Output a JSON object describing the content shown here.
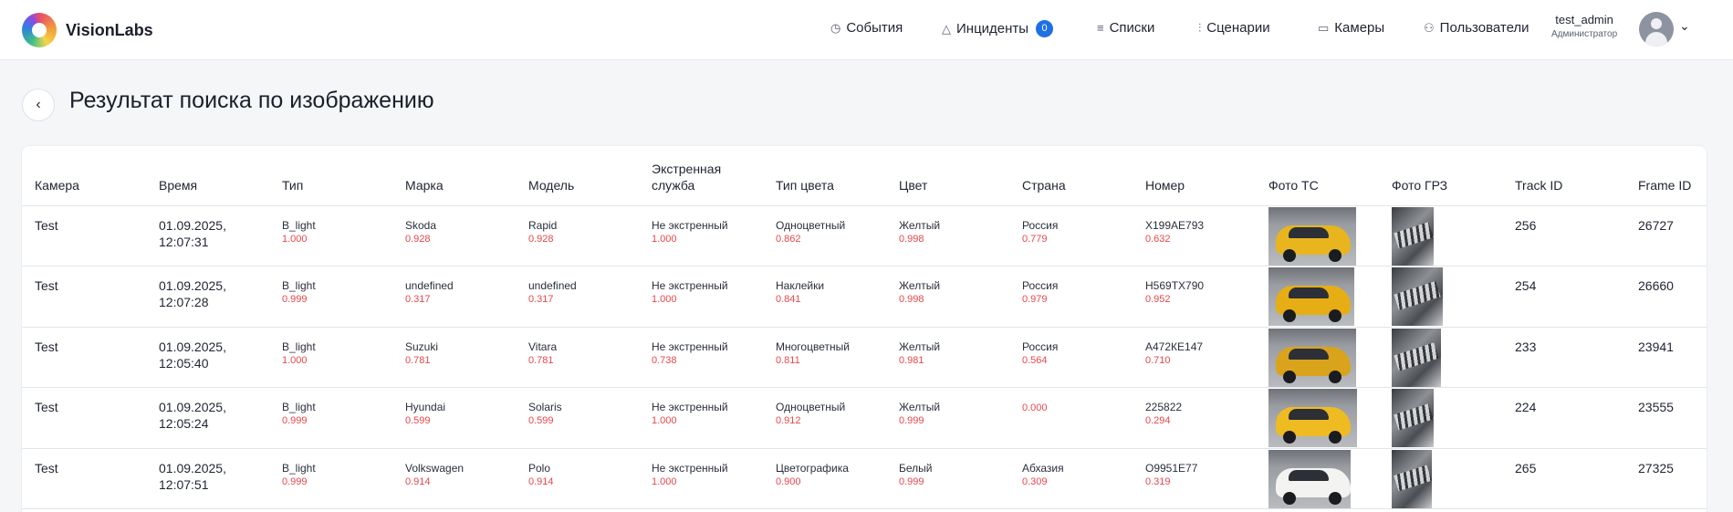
{
  "app": {
    "name": "VisionLabs"
  },
  "nav": [
    {
      "label": "События",
      "icon": "clock-icon",
      "glyph": "◷"
    },
    {
      "label": "Инциденты",
      "icon": "warning-icon",
      "glyph": "△",
      "badge": "0"
    },
    {
      "label": "Списки",
      "icon": "list-icon",
      "glyph": "≡"
    },
    {
      "label": "Сценарии",
      "icon": "sliders-icon",
      "glyph": "⫶"
    },
    {
      "label": "Камеры",
      "icon": "camera-icon",
      "glyph": "▭"
    },
    {
      "label": "Пользователи",
      "icon": "users-icon",
      "glyph": "⚇"
    }
  ],
  "user": {
    "name": "test_admin",
    "role": "Администратор"
  },
  "page": {
    "title": "Результат поиска по изображению",
    "back_glyph": "‹"
  },
  "table": {
    "columns": [
      "Камера",
      "Время",
      "Тип",
      "Марка",
      "Модель",
      "Экстренная служба",
      "Тип цвета",
      "Цвет",
      "Страна",
      "Номер",
      "Фото ТС",
      "Фото ГРЗ",
      "Track ID",
      "Frame ID"
    ],
    "rows": [
      {
        "camera": "Test",
        "time": "01.09.2025, 12:07:31",
        "type": "B_light",
        "type_score": "1.000",
        "make": "Skoda",
        "make_score": "0.928",
        "model": "Rapid",
        "model_score": "0.928",
        "emergency": "Не экстренный",
        "emergency_score": "1.000",
        "color_type": "Одноцветный",
        "color_type_score": "0.862",
        "color": "Желтый",
        "color_score": "0.998",
        "country": "Россия",
        "country_score": "0.779",
        "plate": "Х199АЕ793",
        "plate_score": "0.632",
        "track_id": "256",
        "frame_id": "26727",
        "car_color": "#e8b51f"
      },
      {
        "camera": "Test",
        "time": "01.09.2025, 12:07:28",
        "type": "B_light",
        "type_score": "0.999",
        "make": "undefined",
        "make_score": "0.317",
        "model": "undefined",
        "model_score": "0.317",
        "emergency": "Не экстренный",
        "emergency_score": "1.000",
        "color_type": "Наклейки",
        "color_type_score": "0.841",
        "color": "Желтый",
        "color_score": "0.998",
        "country": "Россия",
        "country_score": "0.979",
        "plate": "Н569ТХ790",
        "plate_score": "0.952",
        "track_id": "254",
        "frame_id": "26660",
        "car_color": "#e6ae14"
      },
      {
        "camera": "Test",
        "time": "01.09.2025, 12:05:40",
        "type": "B_light",
        "type_score": "1.000",
        "make": "Suzuki",
        "make_score": "0.781",
        "model": "Vitara",
        "model_score": "0.781",
        "emergency": "Не экстренный",
        "emergency_score": "0.738",
        "color_type": "Многоцветный",
        "color_type_score": "0.811",
        "color": "Желтый",
        "color_score": "0.981",
        "country": "Россия",
        "country_score": "0.564",
        "plate": "А472КЕ147",
        "plate_score": "0.710",
        "track_id": "233",
        "frame_id": "23941",
        "car_color": "#d9a41c"
      },
      {
        "camera": "Test",
        "time": "01.09.2025, 12:05:24",
        "type": "B_light",
        "type_score": "0.999",
        "make": "Hyundai",
        "make_score": "0.599",
        "model": "Solaris",
        "model_score": "0.599",
        "emergency": "Не экстренный",
        "emergency_score": "1.000",
        "color_type": "Одноцветный",
        "color_type_score": "0.912",
        "color": "Желтый",
        "color_score": "0.999",
        "country": "",
        "country_score": "0.000",
        "plate": "225822",
        "plate_score": "0.294",
        "track_id": "224",
        "frame_id": "23555",
        "car_color": "#efbb22"
      },
      {
        "camera": "Test",
        "time": "01.09.2025, 12:07:51",
        "type": "B_light",
        "type_score": "0.999",
        "make": "Volkswagen",
        "make_score": "0.914",
        "model": "Polo",
        "model_score": "0.914",
        "emergency": "Не экстренный",
        "emergency_score": "1.000",
        "color_type": "Цветографика",
        "color_type_score": "0.900",
        "color": "Белый",
        "color_score": "0.999",
        "country": "Абхазия",
        "country_score": "0.309",
        "plate": "О9951Е77",
        "plate_score": "0.319",
        "track_id": "265",
        "frame_id": "27325",
        "car_color": "#f3f3f1"
      }
    ]
  },
  "colors": {
    "accent": "#1f6fe5",
    "score": "#e8474c",
    "border": "#e1e4e9"
  }
}
